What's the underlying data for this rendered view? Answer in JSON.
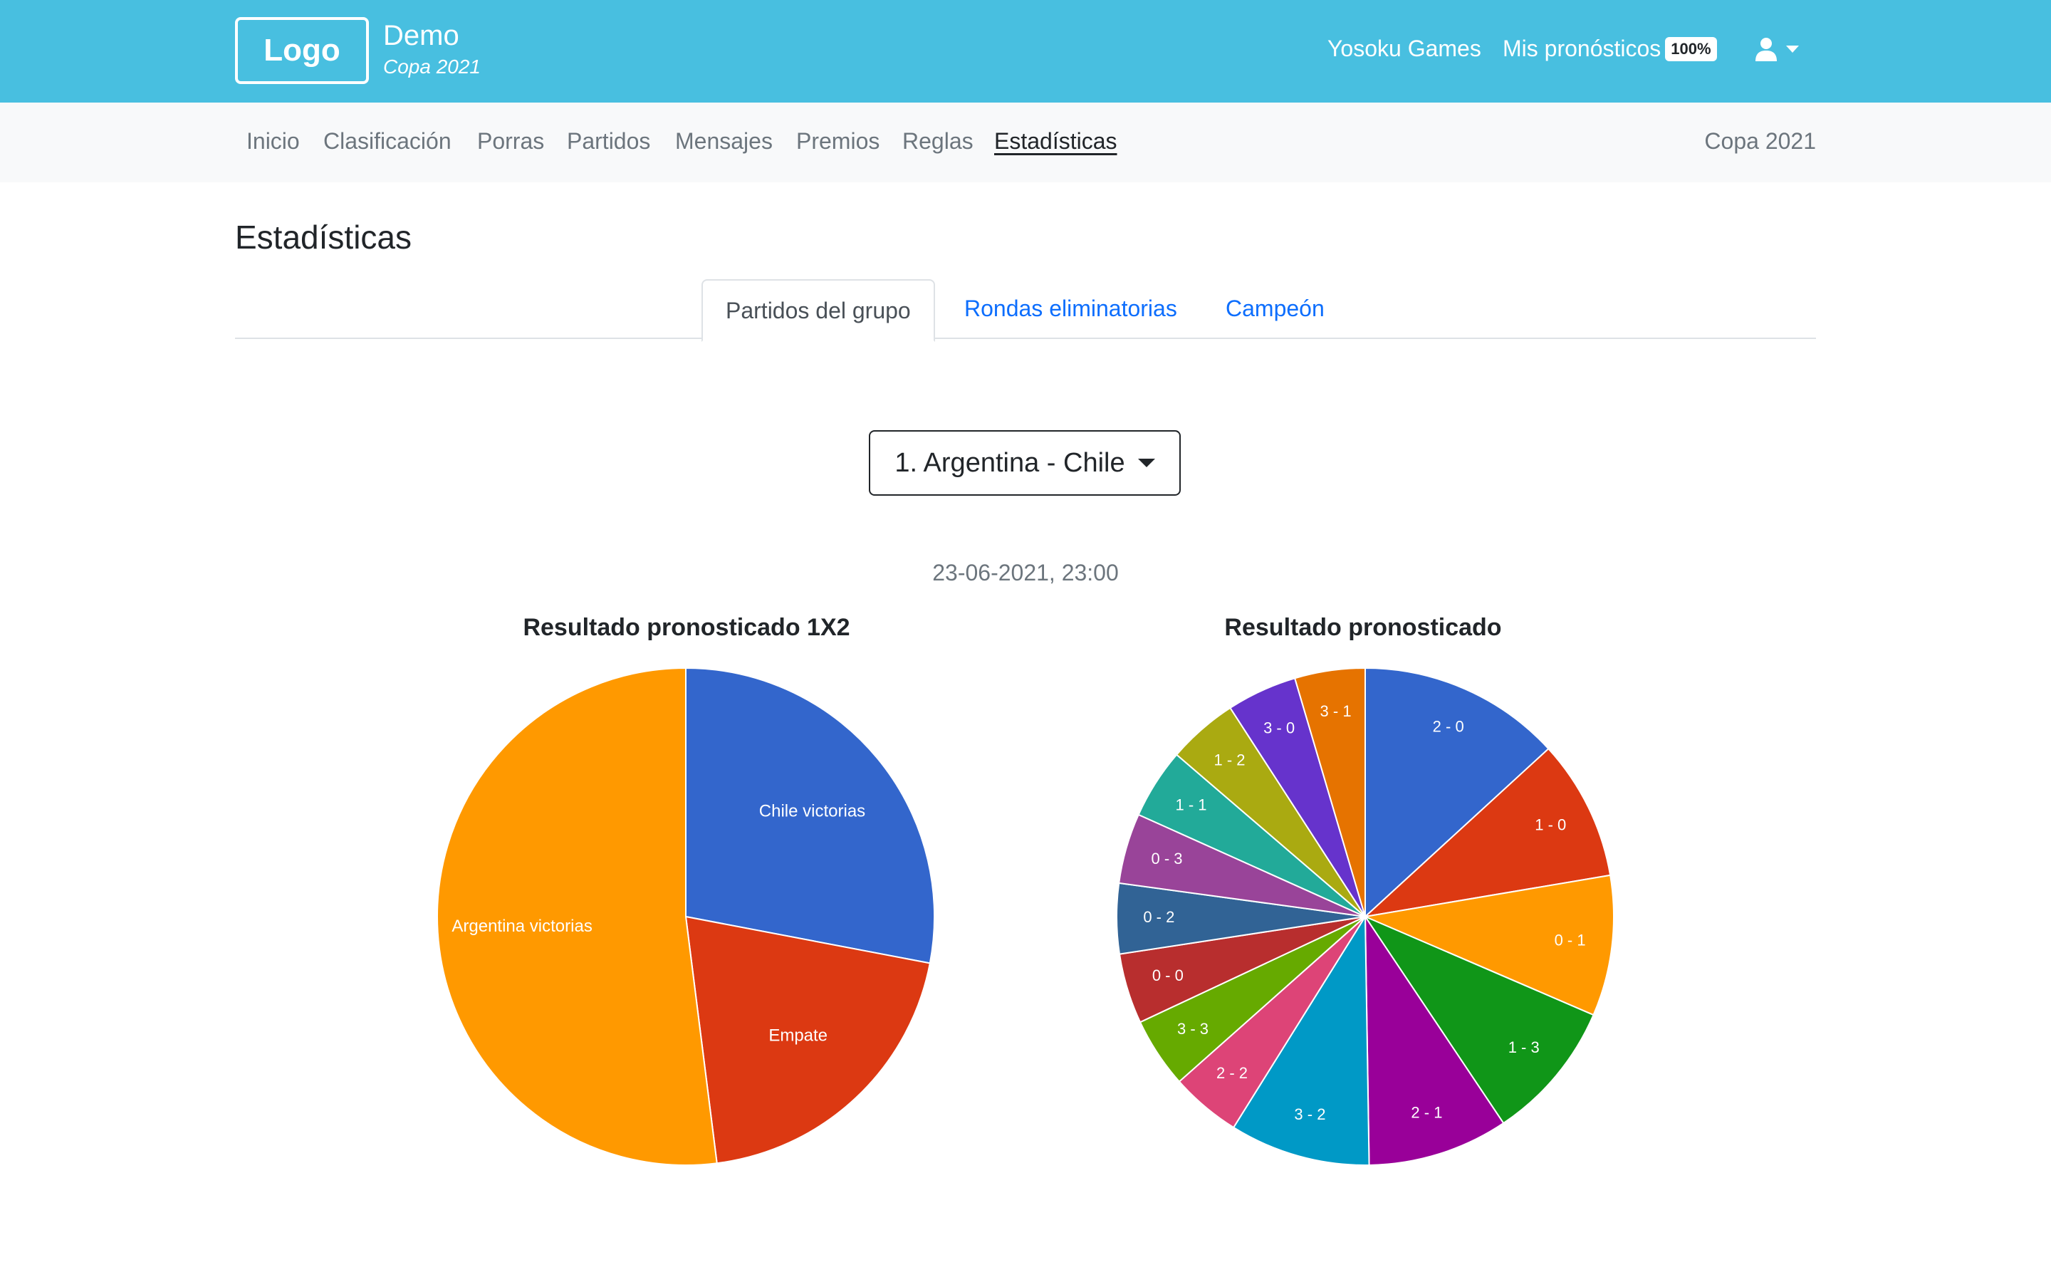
{
  "header": {
    "logo": "Logo",
    "brand_title": "Demo",
    "brand_subtitle": "Copa 2021",
    "links": {
      "yosoku": "Yosoku Games",
      "mis_pronosticos": "Mis pronósticos",
      "badge": "100%"
    }
  },
  "nav": {
    "items": [
      "Inicio",
      "Clasificación",
      "Porras",
      "Partidos",
      "Mensajes",
      "Premios",
      "Reglas",
      "Estadísticas"
    ],
    "active": "Estadísticas",
    "right_label": "Copa 2021"
  },
  "page": {
    "title": "Estadísticas",
    "tabs": [
      "Partidos del grupo",
      "Rondas eliminatorias",
      "Campeón"
    ],
    "active_tab": "Partidos del grupo",
    "match_select": "1. Argentina - Chile",
    "match_date": "23-06-2021, 23:00"
  },
  "colors": {
    "header_bg": "#48bfe0",
    "link_blue": "#0d6efd"
  },
  "chart_data": [
    {
      "type": "pie",
      "title": "Resultado pronosticado 1X2",
      "categories": [
        "Chile victorias",
        "Empate",
        "Argentina victorias"
      ],
      "values": [
        28,
        20,
        52
      ],
      "colors": [
        "#3366cc",
        "#dc3912",
        "#ff9900"
      ]
    },
    {
      "type": "pie",
      "title": "Resultado pronosticado",
      "categories": [
        "2 - 0",
        "1 - 0",
        "0 - 1",
        "1 - 3",
        "2 - 1",
        "3 - 2",
        "2 - 2",
        "3 - 3",
        "0 - 0",
        "0 - 2",
        "0 - 3",
        "1 - 1",
        "1 - 2",
        "3 - 0",
        "3 - 1"
      ],
      "values": [
        13,
        9,
        9,
        9,
        9,
        9,
        4.5,
        4.5,
        4.5,
        4.5,
        4.5,
        4.5,
        4.5,
        4.5,
        4.5
      ],
      "colors": [
        "#3366cc",
        "#dc3912",
        "#ff9900",
        "#109618",
        "#990099",
        "#0099c6",
        "#dd4477",
        "#66aa00",
        "#b82e2e",
        "#316395",
        "#994499",
        "#22aa99",
        "#aaaa11",
        "#6633cc",
        "#e67300"
      ]
    }
  ]
}
